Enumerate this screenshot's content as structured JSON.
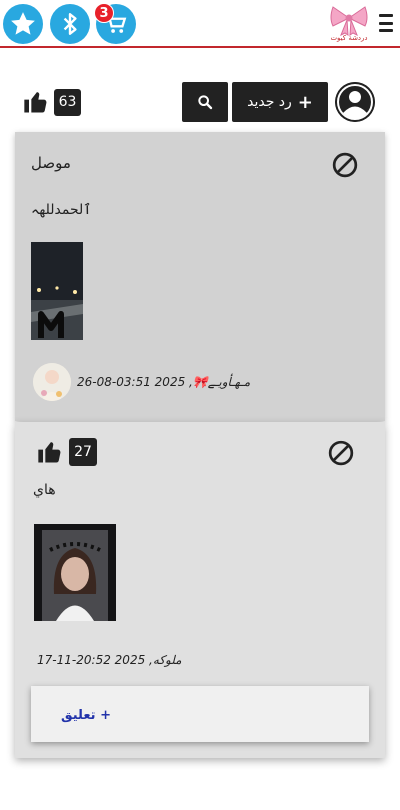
{
  "header": {
    "notification_count": "3",
    "logo_text": "دردشة كيوت",
    "icons": [
      "star-icon",
      "bluetooth-icon",
      "cart-icon",
      "menu-icon"
    ],
    "accent_color": "#c2272d",
    "icon_color": "#29a8e0"
  },
  "toolbar": {
    "likes_count": "63",
    "new_reply_label": "رد جديد",
    "plus_symbol": "+"
  },
  "posts": [
    {
      "title": "موصل",
      "text": "ٱلحمدللهہ",
      "author": "مـهـأويـے🎀",
      "timestamp": "2025 03:51-08-26",
      "attachment": "image"
    },
    {
      "likes": "27",
      "text": "هاي",
      "author": "ملوكه",
      "timestamp": "2025 20:52-11-17",
      "comment_label": "تعليق +"
    }
  ]
}
